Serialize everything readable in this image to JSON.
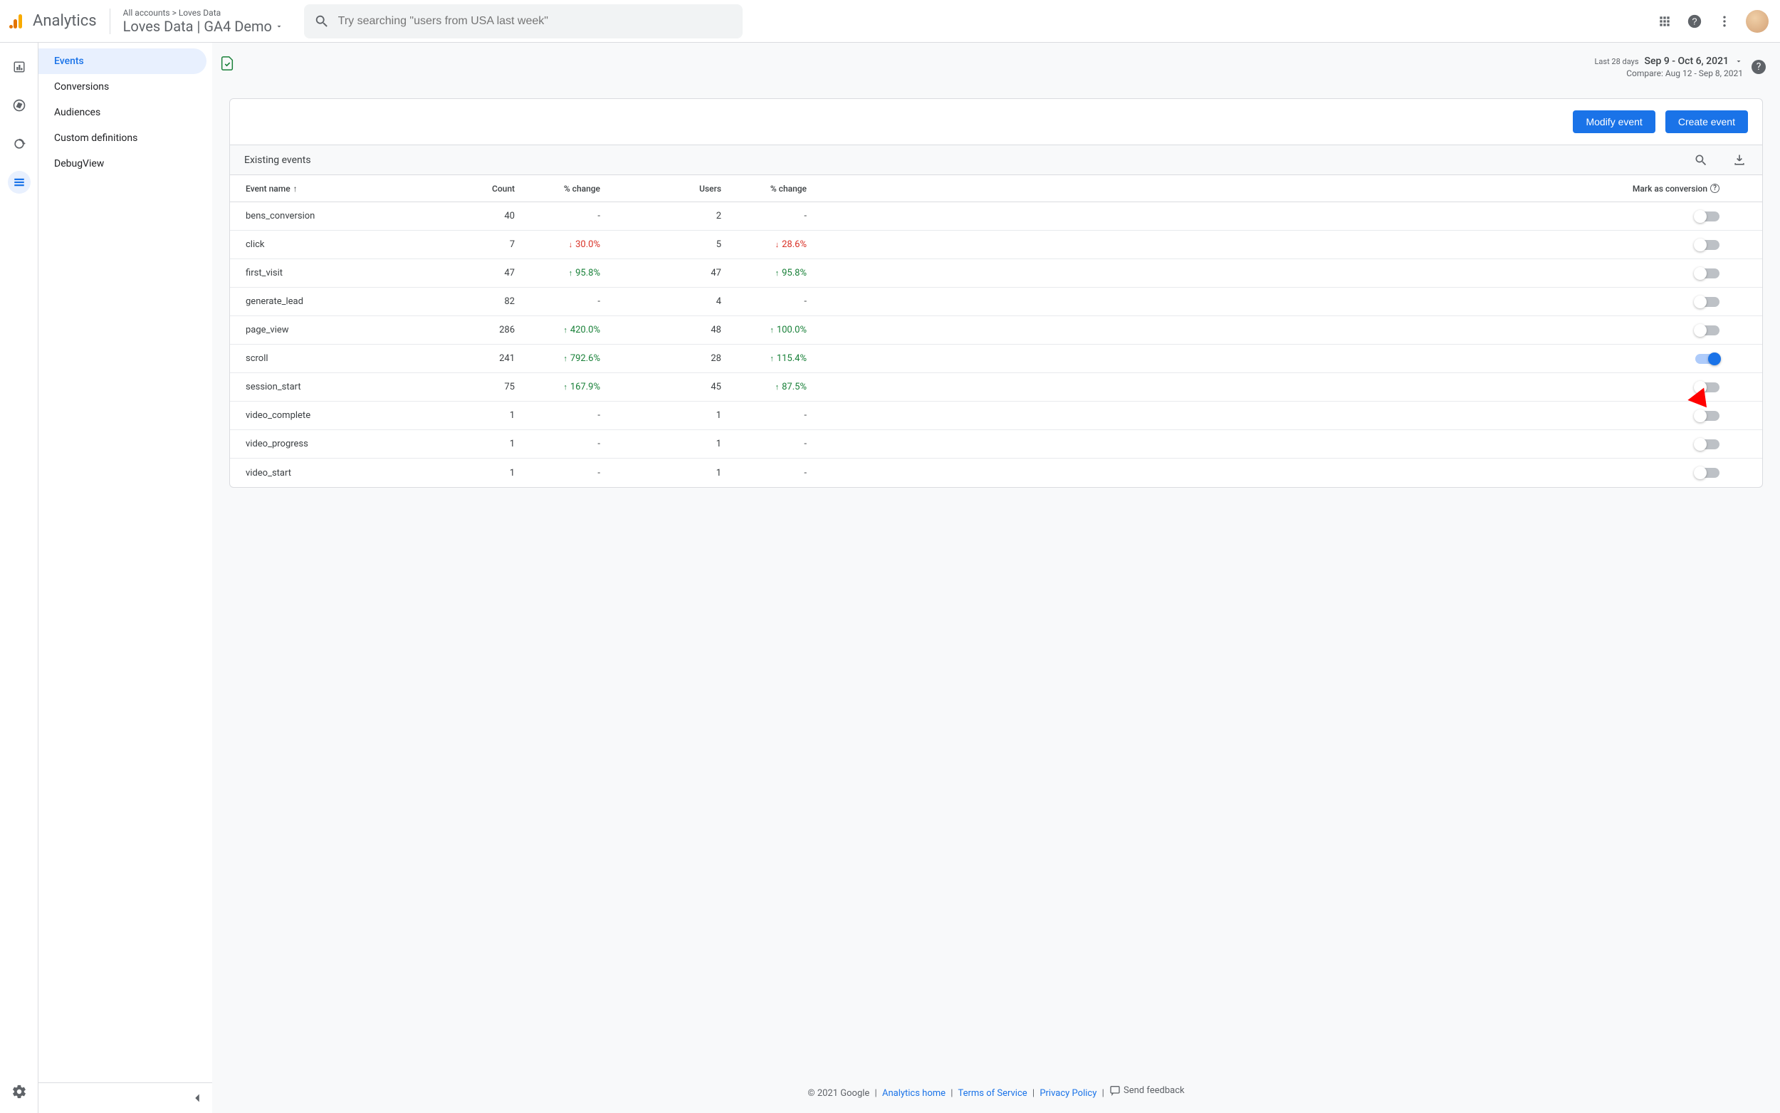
{
  "header": {
    "logo_text": "Analytics",
    "breadcrumb": "All accounts > Loves Data",
    "property_name": "Loves Data | GA4 Demo",
    "search_placeholder": "Try searching \"users from USA last week\""
  },
  "sidebar": {
    "items": [
      {
        "label": "Events",
        "active": true
      },
      {
        "label": "Conversions",
        "active": false
      },
      {
        "label": "Audiences",
        "active": false
      },
      {
        "label": "Custom definitions",
        "active": false
      },
      {
        "label": "DebugView",
        "active": false
      }
    ]
  },
  "date": {
    "last_label": "Last 28 days",
    "range": "Sep 9 - Oct 6, 2021",
    "compare": "Compare: Aug 12 - Sep 8, 2021"
  },
  "buttons": {
    "modify": "Modify event",
    "create": "Create event"
  },
  "table": {
    "title": "Existing events",
    "headers": {
      "name": "Event name",
      "count": "Count",
      "change1": "% change",
      "users": "Users",
      "change2": "% change",
      "mark": "Mark as conversion"
    },
    "rows": [
      {
        "name": "bens_conversion",
        "count": "40",
        "c1": "-",
        "c1dir": "",
        "users": "2",
        "c2": "-",
        "c2dir": "",
        "on": false
      },
      {
        "name": "click",
        "count": "7",
        "c1": "30.0%",
        "c1dir": "down",
        "users": "5",
        "c2": "28.6%",
        "c2dir": "down",
        "on": false
      },
      {
        "name": "first_visit",
        "count": "47",
        "c1": "95.8%",
        "c1dir": "up",
        "users": "47",
        "c2": "95.8%",
        "c2dir": "up",
        "on": false
      },
      {
        "name": "generate_lead",
        "count": "82",
        "c1": "-",
        "c1dir": "",
        "users": "4",
        "c2": "-",
        "c2dir": "",
        "on": false
      },
      {
        "name": "page_view",
        "count": "286",
        "c1": "420.0%",
        "c1dir": "up",
        "users": "48",
        "c2": "100.0%",
        "c2dir": "up",
        "on": false
      },
      {
        "name": "scroll",
        "count": "241",
        "c1": "792.6%",
        "c1dir": "up",
        "users": "28",
        "c2": "115.4%",
        "c2dir": "up",
        "on": true
      },
      {
        "name": "session_start",
        "count": "75",
        "c1": "167.9%",
        "c1dir": "up",
        "users": "45",
        "c2": "87.5%",
        "c2dir": "up",
        "on": false
      },
      {
        "name": "video_complete",
        "count": "1",
        "c1": "-",
        "c1dir": "",
        "users": "1",
        "c2": "-",
        "c2dir": "",
        "on": false
      },
      {
        "name": "video_progress",
        "count": "1",
        "c1": "-",
        "c1dir": "",
        "users": "1",
        "c2": "-",
        "c2dir": "",
        "on": false
      },
      {
        "name": "video_start",
        "count": "1",
        "c1": "-",
        "c1dir": "",
        "users": "1",
        "c2": "-",
        "c2dir": "",
        "on": false
      }
    ]
  },
  "footer": {
    "copyright": "© 2021 Google",
    "links": [
      "Analytics home",
      "Terms of Service",
      "Privacy Policy"
    ],
    "feedback": "Send feedback"
  }
}
